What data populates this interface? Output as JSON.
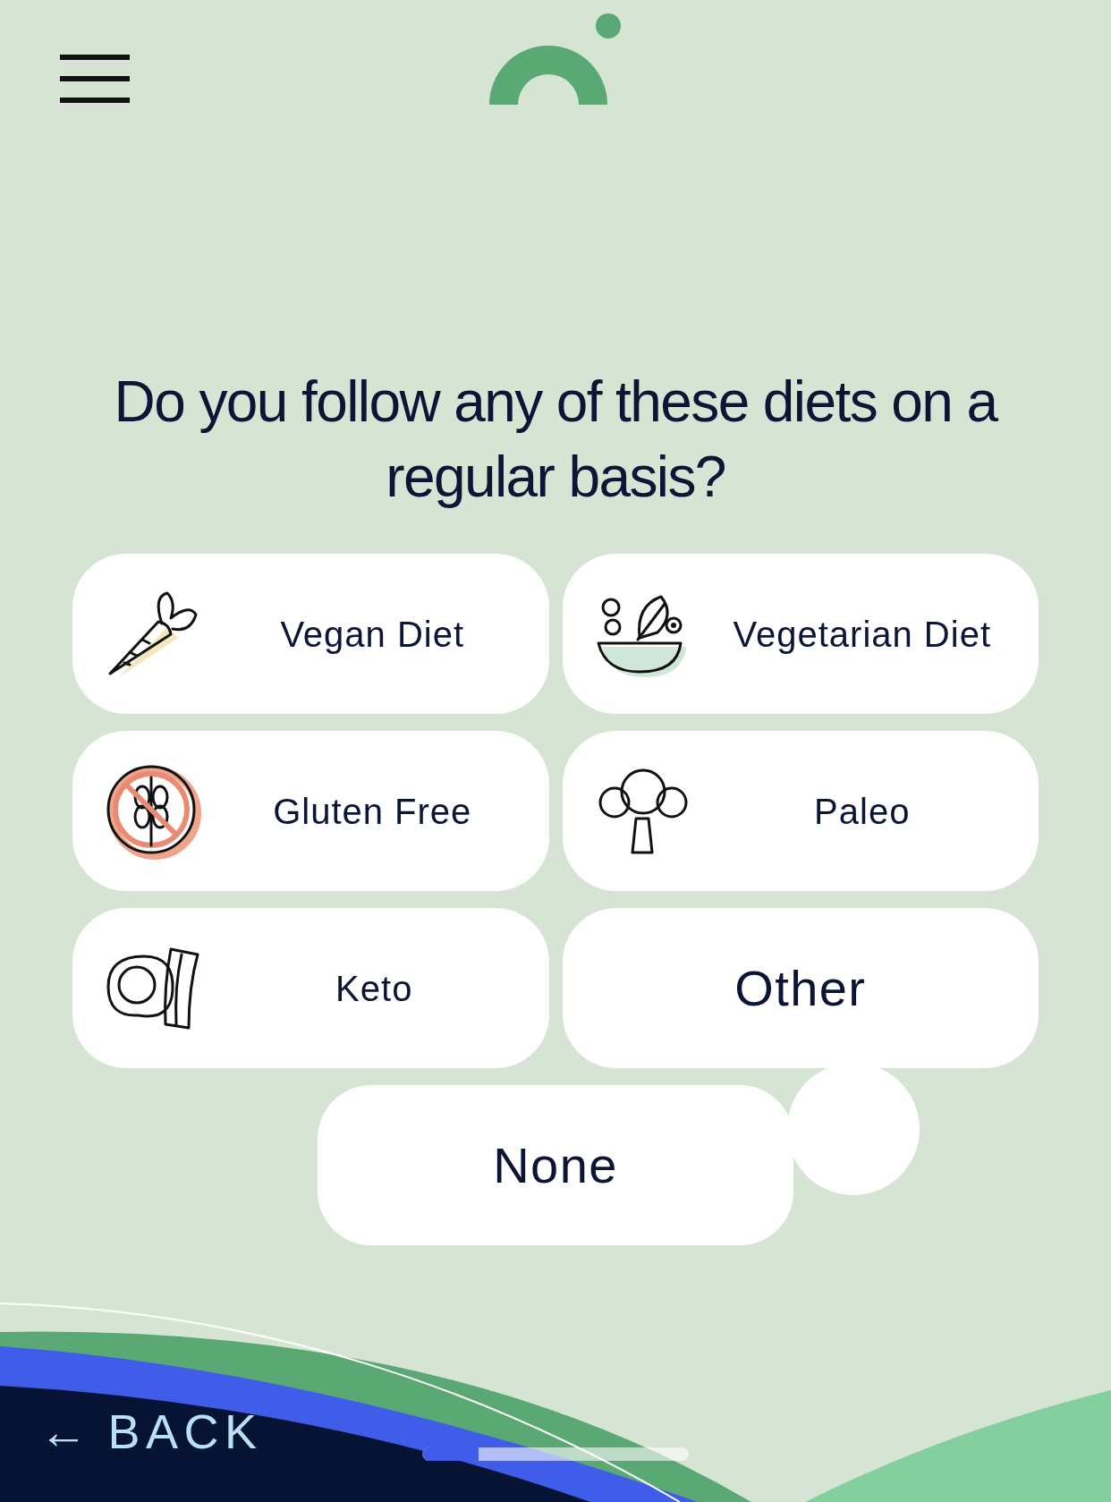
{
  "question": "Do you follow any of these diets on a regular basis?",
  "options": [
    {
      "label": "Vegan Diet",
      "kind": "icon",
      "selected": false
    },
    {
      "label": "Vegetarian Diet",
      "kind": "icon",
      "selected": false
    },
    {
      "label": "Gluten Free",
      "kind": "icon",
      "selected": false
    },
    {
      "label": "Paleo",
      "kind": "icon",
      "selected": false
    },
    {
      "label": "Keto",
      "kind": "icon",
      "selected": false
    },
    {
      "label": "Other",
      "kind": "plain",
      "selected": false
    },
    {
      "label": "None",
      "kind": "plain",
      "selected": false
    }
  ],
  "back_button": {
    "arrow": "←",
    "label": "BACK"
  },
  "progress": {
    "level": 0.21
  }
}
